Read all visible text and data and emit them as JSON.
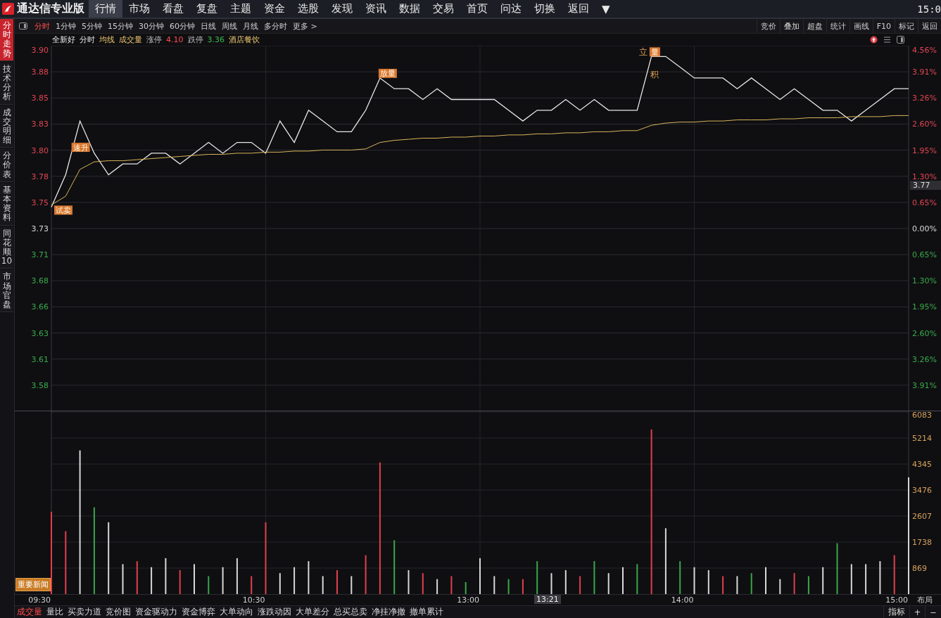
{
  "topbar": {
    "title": "通达信专业版",
    "menu": [
      {
        "label": "行情",
        "selected": true
      },
      {
        "label": "市场",
        "selected": false
      },
      {
        "label": "看盘",
        "selected": false
      },
      {
        "label": "复盘",
        "selected": false
      },
      {
        "label": "主题",
        "selected": false
      },
      {
        "label": "资金",
        "selected": false
      },
      {
        "label": "选股",
        "selected": false
      },
      {
        "label": "发现",
        "selected": false
      },
      {
        "label": "资讯",
        "selected": false
      },
      {
        "label": "数据",
        "selected": false
      },
      {
        "label": "交易",
        "selected": false
      },
      {
        "label": "首页",
        "selected": false
      },
      {
        "label": "问达",
        "selected": false
      },
      {
        "label": "切换",
        "selected": false
      },
      {
        "label": "返回",
        "selected": false
      }
    ],
    "dropdown": "▼",
    "clock": "15:0"
  },
  "side_tabs": [
    {
      "label": "分时走势",
      "selected": true
    },
    {
      "label": "技术分析",
      "selected": false
    },
    {
      "label": "成交明细",
      "selected": false
    },
    {
      "label": "分价表",
      "selected": false
    },
    {
      "label": "基本资料",
      "selected": false
    },
    {
      "label": "同花顺10",
      "selected": false
    },
    {
      "label": "市场官盘",
      "selected": false
    }
  ],
  "periods": [
    {
      "label": "分时",
      "selected": true
    },
    {
      "label": "1分钟",
      "selected": false
    },
    {
      "label": "5分钟",
      "selected": false
    },
    {
      "label": "15分钟",
      "selected": false
    },
    {
      "label": "30分钟",
      "selected": false
    },
    {
      "label": "60分钟",
      "selected": false
    },
    {
      "label": "日线",
      "selected": false
    },
    {
      "label": "周线",
      "selected": false
    },
    {
      "label": "月线",
      "selected": false
    },
    {
      "label": "多分时",
      "selected": false
    },
    {
      "label": "更多 >",
      "selected": false
    }
  ],
  "tools": [
    "竞价",
    "叠加",
    "超盘",
    "统计",
    "画线",
    "F10",
    "标记",
    "返回"
  ],
  "info": [
    {
      "text": "全新好",
      "kind": "name"
    },
    {
      "text": "分时",
      "kind": "name"
    },
    {
      "text": "均线",
      "kind": "indicator"
    },
    {
      "text": "成交量",
      "kind": "indicator"
    },
    {
      "text": "涨停",
      "kind": "caption"
    },
    {
      "text": "4.10",
      "kind": "up"
    },
    {
      "text": "跌停",
      "kind": "caption"
    },
    {
      "text": "3.36",
      "kind": "down"
    },
    {
      "text": "酒店餐饮",
      "kind": "indicator"
    }
  ],
  "price_chart": {
    "current_price_label": "3.77",
    "percent_labels": [
      "4.56%",
      "3.91%",
      "3.26%",
      "2.60%",
      "1.95%",
      "1.30%",
      "0.65%",
      "0.00%",
      "0.65%",
      "1.30%",
      "1.95%",
      "2.60%",
      "3.26%",
      "3.91%"
    ],
    "signal_marks": [
      "立",
      "积"
    ],
    "chart_data": {
      "type": "line",
      "grid": true,
      "ylim": [
        3.56,
        3.9
      ],
      "yticks": [
        {
          "value": 3.9,
          "label": "3.90"
        },
        {
          "value": 3.8757,
          "label": "3.88"
        },
        {
          "value": 3.8514,
          "label": "3.85"
        },
        {
          "value": 3.8271,
          "label": "3.83"
        },
        {
          "value": 3.8029,
          "label": "3.80"
        },
        {
          "value": 3.7786,
          "label": "3.78"
        },
        {
          "value": 3.7543,
          "label": "3.75"
        },
        {
          "value": 3.73,
          "label": "3.73"
        },
        {
          "value": 3.7057,
          "label": "3.71"
        },
        {
          "value": 3.6814,
          "label": "3.68"
        },
        {
          "value": 3.6571,
          "label": "3.66"
        },
        {
          "value": 3.6329,
          "label": "3.63"
        },
        {
          "value": 3.6086,
          "label": "3.61"
        },
        {
          "value": 3.5843,
          "label": "3.58"
        }
      ],
      "series": [
        {
          "color": "#e8e8e8",
          "values": [
            3.75,
            3.78,
            3.83,
            3.8,
            3.78,
            3.79,
            3.79,
            3.8,
            3.8,
            3.79,
            3.8,
            3.81,
            3.8,
            3.81,
            3.81,
            3.8,
            3.83,
            3.81,
            3.84,
            3.83,
            3.82,
            3.82,
            3.84,
            3.87,
            3.86,
            3.86,
            3.85,
            3.86,
            3.85,
            3.85,
            3.85,
            3.85,
            3.84,
            3.83,
            3.84,
            3.84,
            3.85,
            3.84,
            3.85,
            3.84,
            3.84,
            3.84,
            3.89,
            3.89,
            3.88,
            3.87,
            3.87,
            3.87,
            3.86,
            3.87,
            3.86,
            3.85,
            3.86,
            3.85,
            3.84,
            3.84,
            3.83,
            3.84,
            3.85,
            3.86,
            3.86
          ]
        },
        {
          "color": "#d9b45a",
          "values": [
            3.752,
            3.76,
            3.785,
            3.792,
            3.793,
            3.793,
            3.794,
            3.795,
            3.796,
            3.797,
            3.798,
            3.799,
            3.799,
            3.8,
            3.8,
            3.801,
            3.801,
            3.802,
            3.802,
            3.803,
            3.803,
            3.803,
            3.804,
            3.81,
            3.812,
            3.813,
            3.814,
            3.814,
            3.815,
            3.815,
            3.816,
            3.816,
            3.817,
            3.817,
            3.818,
            3.818,
            3.819,
            3.819,
            3.82,
            3.82,
            3.821,
            3.821,
            3.826,
            3.828,
            3.829,
            3.829,
            3.83,
            3.83,
            3.831,
            3.831,
            3.831,
            3.832,
            3.832,
            3.833,
            3.833,
            3.833,
            3.834,
            3.834,
            3.834,
            3.835,
            3.835
          ]
        }
      ],
      "annotations": [
        "试卖",
        "速升",
        "放量",
        "量"
      ]
    }
  },
  "volume_chart": {
    "news_button": "重要新闻",
    "chart_data": {
      "type": "bar",
      "stacked": true,
      "grid": true,
      "ylim": [
        0,
        6083
      ],
      "yticks": [
        {
          "value": 869,
          "label": "869"
        },
        {
          "value": 1738,
          "label": "1738"
        },
        {
          "value": 2607,
          "label": "2607"
        },
        {
          "value": 3476,
          "label": "3476"
        },
        {
          "value": 4345,
          "label": "4345"
        },
        {
          "value": 5214,
          "label": "5214"
        },
        {
          "value": 6083,
          "label": "6083"
        }
      ],
      "series": [
        {
          "color": "#e0404a",
          "values": [
            2750,
            2100,
            null,
            null,
            null,
            null,
            1100,
            null,
            null,
            800,
            null,
            null,
            null,
            null,
            600,
            2400,
            null,
            null,
            null,
            null,
            800,
            null,
            1300,
            4400,
            null,
            null,
            700,
            null,
            600,
            null,
            null,
            null,
            null,
            500,
            null,
            null,
            null,
            600,
            null,
            null,
            null,
            null,
            5500,
            null,
            null,
            null,
            null,
            600,
            null,
            null,
            null,
            null,
            700,
            null,
            null,
            null,
            null,
            null,
            null,
            1300,
            null
          ]
        },
        {
          "color": "#3aa64a",
          "values": [
            null,
            null,
            null,
            2900,
            null,
            null,
            null,
            null,
            null,
            null,
            null,
            600,
            null,
            null,
            null,
            null,
            null,
            null,
            null,
            null,
            null,
            null,
            null,
            null,
            1800,
            null,
            null,
            null,
            null,
            400,
            null,
            null,
            500,
            null,
            1100,
            null,
            null,
            null,
            1100,
            null,
            null,
            1000,
            null,
            null,
            1100,
            null,
            null,
            null,
            null,
            700,
            null,
            null,
            null,
            600,
            null,
            1700,
            null,
            null,
            null,
            null,
            null
          ]
        },
        {
          "color": "#d8d8d8",
          "values": [
            null,
            null,
            4800,
            null,
            2400,
            1000,
            null,
            900,
            1200,
            null,
            1000,
            null,
            900,
            1200,
            null,
            null,
            700,
            900,
            1100,
            600,
            null,
            600,
            null,
            null,
            null,
            800,
            null,
            500,
            null,
            null,
            1200,
            600,
            null,
            null,
            null,
            700,
            800,
            null,
            null,
            700,
            900,
            null,
            null,
            2200,
            null,
            900,
            800,
            null,
            600,
            null,
            900,
            500,
            null,
            null,
            900,
            null,
            1000,
            1000,
            1100,
            null,
            3900
          ]
        }
      ]
    }
  },
  "time_axis": {
    "labels": [
      "09:30",
      "10:30",
      "13:00",
      "14:00",
      "15:00"
    ],
    "cursor_label": "13:21",
    "layout_button": "布局"
  },
  "indicator_tabs": [
    {
      "label": "成交量",
      "selected": true
    },
    {
      "label": "量比",
      "selected": false
    },
    {
      "label": "买卖力道",
      "selected": false
    },
    {
      "label": "竞价图",
      "selected": false
    },
    {
      "label": "资金驱动力",
      "selected": false
    },
    {
      "label": "资金博弈",
      "selected": false
    },
    {
      "label": "大单动向",
      "selected": false
    },
    {
      "label": "涨跌动因",
      "selected": false
    },
    {
      "label": "大单差分",
      "selected": false
    },
    {
      "label": "总买总卖",
      "selected": false
    },
    {
      "label": "净挂净撤",
      "selected": false
    },
    {
      "label": "撤单累计",
      "selected": false
    }
  ],
  "indicator_controls": [
    "指标",
    "+",
    "−"
  ]
}
